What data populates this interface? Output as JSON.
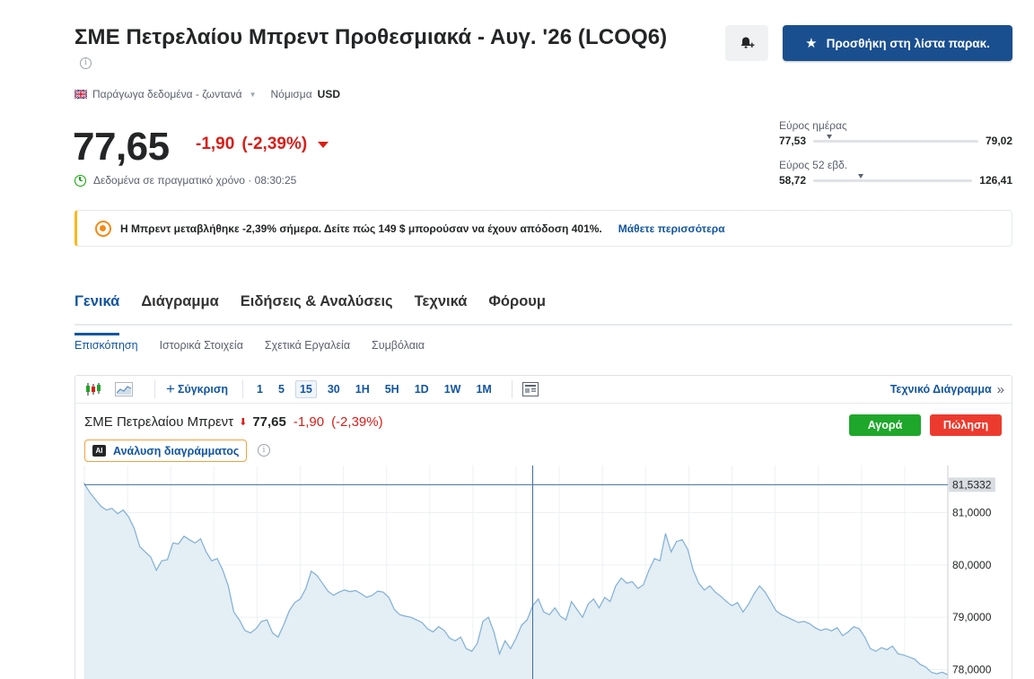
{
  "header": {
    "title": "ΣΜΕ Πετρελαίου Μπρεντ Προθεσμιακά - Αυγ. '26 (LCOQ6)",
    "watchlist_button": "Προσθήκη στη λίστα παρακ.",
    "data_source": "Παράγωγα δεδομένα - ζωντανά",
    "currency_label": "Νόμισμα",
    "currency": "USD"
  },
  "quote": {
    "price": "77,65",
    "change": "-1,90",
    "change_pct": "(-2,39%)",
    "realtime_label": "Δεδομένα σε πραγματικό χρόνο · 08:30:25"
  },
  "ranges": {
    "day": {
      "label": "Εύρος ημέρας",
      "low": "77,53",
      "high": "79,02",
      "position": 0.08
    },
    "week52": {
      "label": "Εύρος 52 εβδ.",
      "low": "58,72",
      "high": "126,41",
      "position": 0.28
    }
  },
  "promo": {
    "text": "Η Μπρεντ μεταβλήθηκε -2,39% σήμερα. Δείτε πώς 149 $ μπορούσαν να έχουν απόδοση 401%.",
    "link": "Μάθετε περισσότερα"
  },
  "tabs": [
    "Γενικά",
    "Διάγραμμα",
    "Ειδήσεις & Αναλύσεις",
    "Τεχνικά",
    "Φόρουμ"
  ],
  "subtabs": [
    "Επισκόπηση",
    "Ιστορικά Στοιχεία",
    "Σχετικά Εργαλεία",
    "Συμβόλαια"
  ],
  "toolbar": {
    "compare": "Σύγκριση",
    "timeframes": [
      "1",
      "5",
      "15",
      "30",
      "1H",
      "5H",
      "1D",
      "1W",
      "1M"
    ],
    "selected_timeframe": "15",
    "tech_chart_link": "Τεχνικό Διάγραμμα"
  },
  "chart_header": {
    "name": "ΣΜΕ Πετρελαίου Μπρεντ",
    "price": "77,65",
    "change": "-1,90",
    "change_pct": "(-2,39%)",
    "buy": "Αγορά",
    "sell": "Πώληση",
    "ai_analysis": "Ανάλυση διαγράμματος"
  },
  "colors": {
    "accent_blue": "#1256a0",
    "button_blue": "#1a4f8f",
    "down_red": "#d91e18",
    "buy_green": "#1ea72a",
    "sell_red": "#ec3b2e",
    "series_line": "#7fb0d6",
    "series_fill": "#e4eef5"
  },
  "chart_data": {
    "type": "area",
    "y_ticks": [
      "81,0000",
      "80,0000",
      "79,0000",
      "78,0000"
    ],
    "ylim": [
      77.7,
      81.9
    ],
    "crosshair_value": 81.5332,
    "crosshair_label": "81,5332",
    "crosshair_index": 81,
    "grid": true,
    "series": [
      {
        "values": [
          81.55,
          81.38,
          81.25,
          81.12,
          81.05,
          81.08,
          80.98,
          81.05,
          80.92,
          80.7,
          80.35,
          80.25,
          80.15,
          79.9,
          80.08,
          80.1,
          80.42,
          80.4,
          80.55,
          80.48,
          80.42,
          80.5,
          80.25,
          80.08,
          80.12,
          79.9,
          79.6,
          79.1,
          78.95,
          78.75,
          78.7,
          78.78,
          78.92,
          78.95,
          78.7,
          78.62,
          78.85,
          79.12,
          79.28,
          79.35,
          79.55,
          79.88,
          79.8,
          79.65,
          79.5,
          79.42,
          79.48,
          79.52,
          79.49,
          79.51,
          79.45,
          79.38,
          79.42,
          79.5,
          79.48,
          79.38,
          79.15,
          79.05,
          79.02,
          79.0,
          78.95,
          78.9,
          78.78,
          78.72,
          78.82,
          78.75,
          78.6,
          78.55,
          78.62,
          78.4,
          78.35,
          78.5,
          78.92,
          79.0,
          78.72,
          78.3,
          78.55,
          78.4,
          78.6,
          78.85,
          78.95,
          79.22,
          79.35,
          79.1,
          79.05,
          79.18,
          79.02,
          78.95,
          79.3,
          79.15,
          79.0,
          79.25,
          79.35,
          79.18,
          79.38,
          79.3,
          79.6,
          79.75,
          79.65,
          79.68,
          79.55,
          79.62,
          79.9,
          80.12,
          80.08,
          80.6,
          80.25,
          80.45,
          80.48,
          80.3,
          79.9,
          79.65,
          79.52,
          79.6,
          79.48,
          79.4,
          79.3,
          79.22,
          79.28,
          79.1,
          79.25,
          79.45,
          79.6,
          79.48,
          79.3,
          79.12,
          79.05,
          79.0,
          78.95,
          78.9,
          78.92,
          78.88,
          78.8,
          78.75,
          78.78,
          78.74,
          78.8,
          78.65,
          78.72,
          78.82,
          78.78,
          78.62,
          78.4,
          78.35,
          78.42,
          78.38,
          78.45,
          78.3,
          78.28,
          78.24,
          78.2,
          78.1,
          78.05,
          77.95,
          77.92,
          77.95,
          77.9
        ]
      }
    ]
  }
}
